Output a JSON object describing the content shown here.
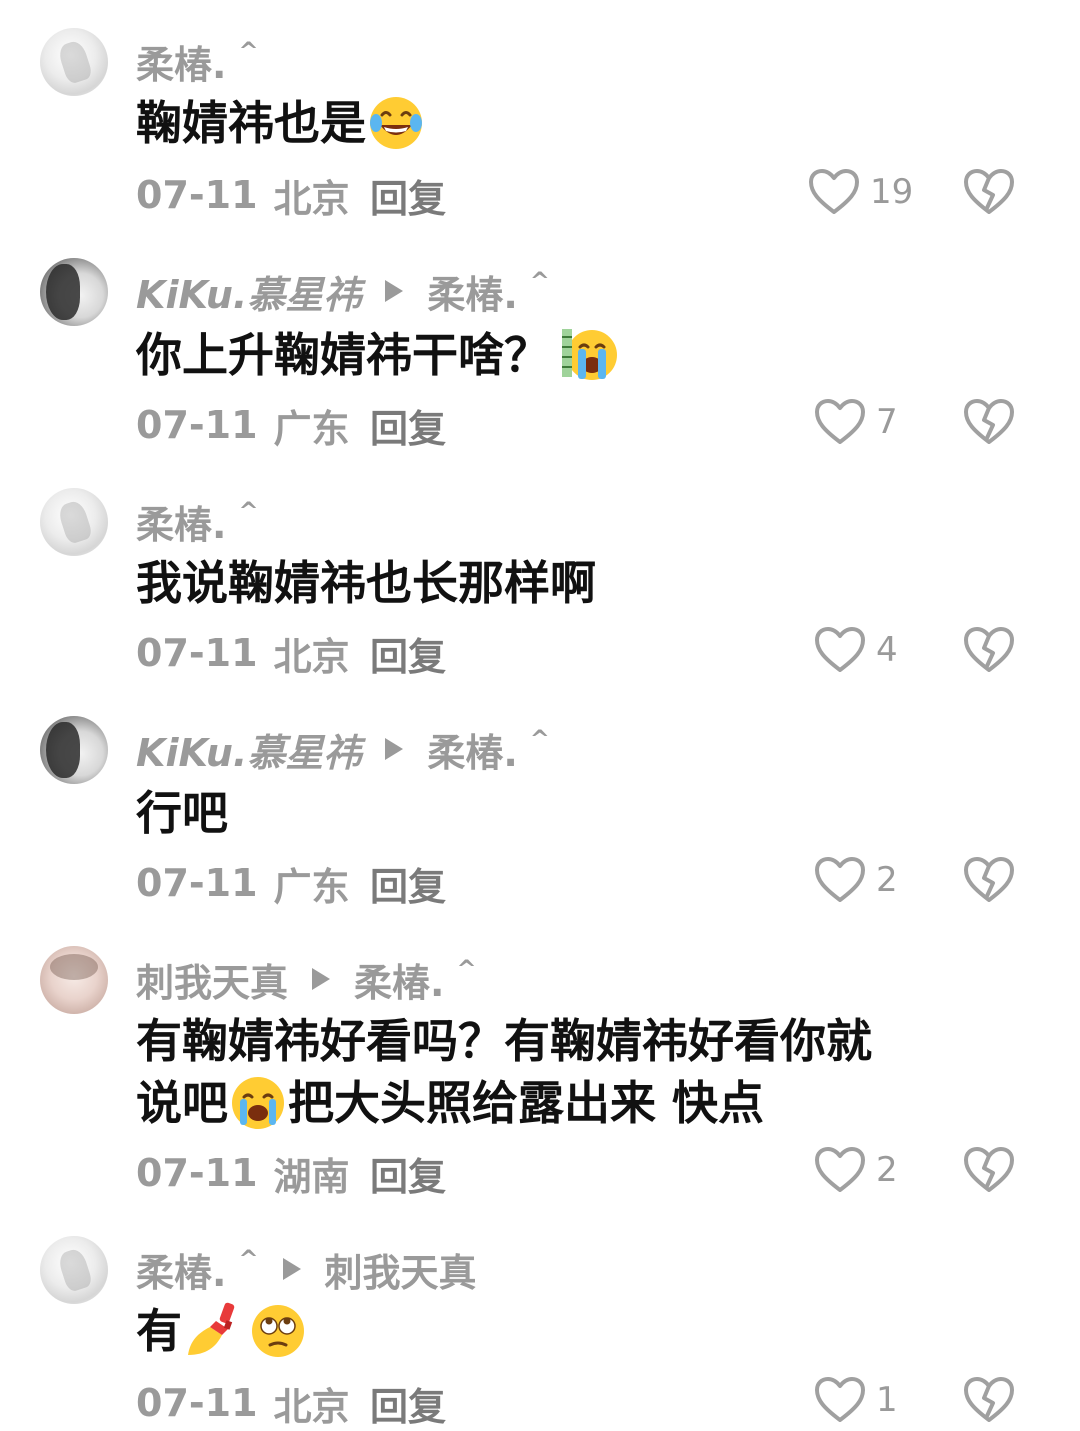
{
  "comments": [
    {
      "author": "柔椿.",
      "author_caret": "^",
      "reply_to": "",
      "text": "鞠婧祎也是",
      "emoji": "face-with-tears-of-joy",
      "date": "07-11",
      "location": "北京",
      "reply_label": "回复",
      "likes": "19"
    },
    {
      "author": "KiKu.慕星祎",
      "author_caret": "",
      "reply_to": "柔椿.",
      "reply_to_caret": "^",
      "text": "你上升鞠婧祎干啥？",
      "emoji": "loudly-crying-face",
      "date": "07-11",
      "location": "广东",
      "reply_label": "回复",
      "likes": "7"
    },
    {
      "author": "柔椿.",
      "author_caret": "^",
      "reply_to": "",
      "text": "我说鞠婧祎也长那样啊",
      "date": "07-11",
      "location": "北京",
      "reply_label": "回复",
      "likes": "4"
    },
    {
      "author": "KiKu.慕星祎",
      "author_caret": "",
      "reply_to": "柔椿.",
      "reply_to_caret": "^",
      "text": "行吧",
      "date": "07-11",
      "location": "广东",
      "reply_label": "回复",
      "likes": "2"
    },
    {
      "author": "刺我天真",
      "author_caret": "",
      "reply_to": "柔椿.",
      "reply_to_caret": "^",
      "text_line1": "有鞠婧祎好看吗？有鞠婧祎好看你就",
      "text_line2_a": "说吧",
      "text_line2_b": "把大头照给露出来 快点",
      "emoji": "loudly-crying-face",
      "date": "07-11",
      "location": "湖南",
      "reply_label": "回复",
      "likes": "2"
    },
    {
      "author": "柔椿.",
      "author_caret": "^",
      "reply_to": "刺我天真",
      "text": "有",
      "emoji": [
        "nail-polish",
        "face-with-rolling-eyes"
      ],
      "date": "07-11",
      "location": "北京",
      "reply_label": "回复",
      "likes": "1"
    }
  ],
  "colors": {
    "meta_gray": "#9a9a9a",
    "reply_gray": "#7a7a7a",
    "text": "#111111",
    "emoji_yellow": "#ffcc33"
  },
  "icons": {
    "like": "heart-outline-icon",
    "dislike": "broken-heart-outline-icon",
    "reply_arrow": "triangle-right-icon"
  }
}
